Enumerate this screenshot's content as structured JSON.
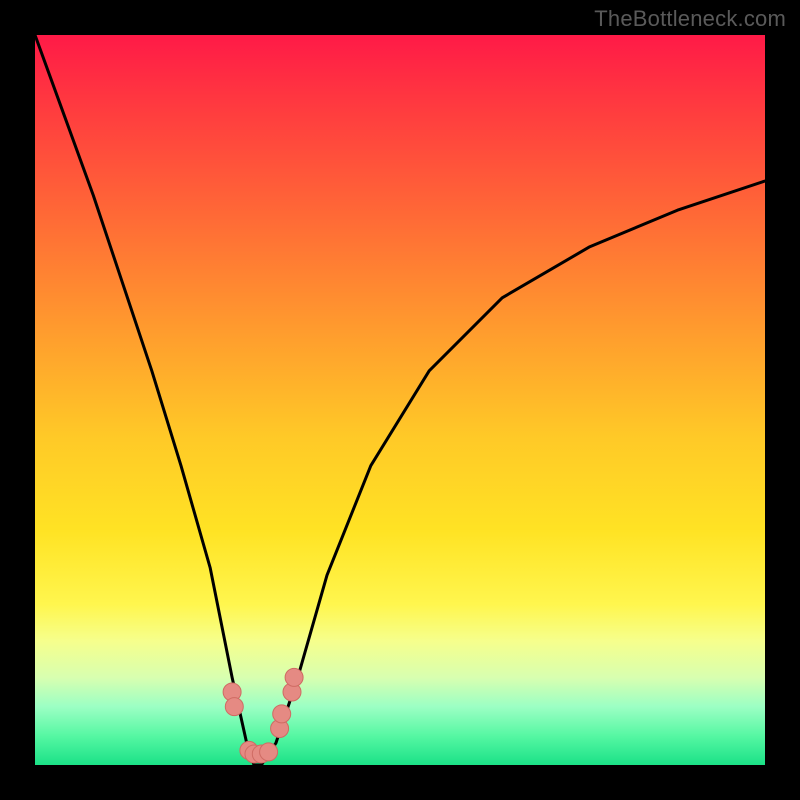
{
  "watermark": "TheBottleneck.com",
  "chart_data": {
    "type": "line",
    "title": "",
    "xlabel": "",
    "ylabel": "",
    "xlim": [
      0,
      100
    ],
    "ylim": [
      0,
      100
    ],
    "grid": false,
    "series": [
      {
        "name": "bottleneck-curve",
        "x": [
          0,
          4,
          8,
          12,
          16,
          20,
          24,
          27,
          29,
          30,
          31,
          33,
          36,
          40,
          46,
          54,
          64,
          76,
          88,
          100
        ],
        "values": [
          100,
          89,
          78,
          66,
          54,
          41,
          27,
          12,
          3,
          0,
          0,
          3,
          12,
          26,
          41,
          54,
          64,
          71,
          76,
          80
        ]
      }
    ],
    "markers": {
      "name": "dip-markers",
      "x": [
        27.0,
        27.3,
        29.3,
        30.0,
        31.0,
        32.0,
        33.5,
        33.8,
        35.2,
        35.5
      ],
      "values": [
        10.0,
        8.0,
        2.0,
        1.5,
        1.5,
        1.8,
        5.0,
        7.0,
        10.0,
        12.0
      ]
    },
    "colors": {
      "curve": "#000000",
      "marker_fill": "#e58a83",
      "marker_stroke": "#cf6b63"
    }
  }
}
